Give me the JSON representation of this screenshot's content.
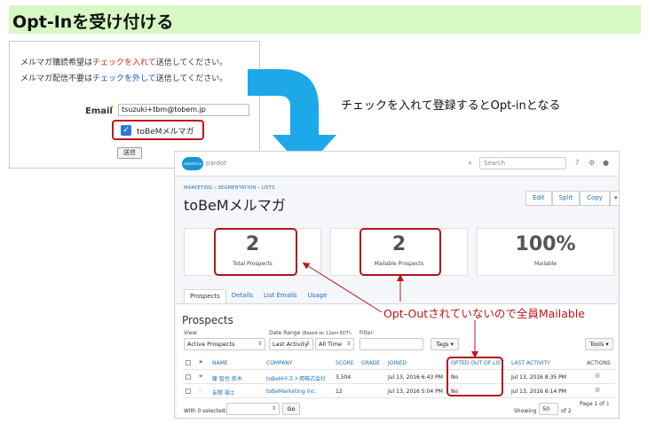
{
  "title": "Opt-Inを受け付ける",
  "form": {
    "line1": {
      "pre": "メルマガ購読希望は",
      "hl": "チェックを入れて",
      "post": "送信してください。"
    },
    "line2": {
      "pre": "メルマガ配信不要は",
      "hl": "チェックを外して",
      "post": "送信してください。"
    },
    "email_label": "Email",
    "required_mark": "*",
    "email_value": "tsuzuki+tbm@tobem.jp",
    "checkbox_label": "toBeMメルマガ",
    "submit_label": "送信"
  },
  "caption": "チェックを入れて登録するとOpt-inとなる",
  "pardot": {
    "logo_text": "salesforce",
    "product": "pardot",
    "search_placeholder": "Search",
    "help_icon": "?",
    "breadcrumb": "MARKETING  ›  SEGMENTATION  ›  LISTS",
    "page_title": "toBeMメルマガ",
    "buttons": [
      "Edit",
      "Split",
      "Copy",
      "▾"
    ],
    "stats": [
      {
        "value": "2",
        "label": "Total Prospects"
      },
      {
        "value": "2",
        "label": "Mailable Prospects"
      },
      {
        "value": "100%",
        "label": "Mailable"
      }
    ],
    "tabs": [
      "Prospects",
      "Details",
      "List Emails",
      "Usage"
    ],
    "section_title": "Prospects",
    "view_label": "View:",
    "view_value": "Active Prospects",
    "date_label": "Date Range",
    "date_note": "(Based on 12am EDT):",
    "date_value1": "Last Activity",
    "date_value2": "All Time",
    "filter_label": "Filter:",
    "tags_label": "Tags ▾",
    "tools_label": "Tools ▾",
    "columns": [
      "NAME",
      "COMPANY",
      "SCORE",
      "GRADE",
      "JOINED",
      "OPTED OUT OF LIST",
      "LAST ACTIVITY",
      "ACTIONS"
    ],
    "rows": [
      {
        "name": "藤 智也 郎木",
        "company": "toBeMテスト用株式会社",
        "score": "3,504",
        "grade": "",
        "joined": "Jul 13, 2016 6:43 PM",
        "opted_out": "No",
        "last_activity": "Jul 13, 2016 8:35 PM"
      },
      {
        "name": "友際 福士",
        "company": "toBeMarketing inc.",
        "score": "12",
        "grade": "",
        "joined": "Jul 13, 2016 5:04 PM",
        "opted_out": "No",
        "last_activity": "Jul 13, 2016 6:14 PM"
      }
    ],
    "selected_label": "With 0 selected:",
    "go_label": "Go",
    "showing_label": "Showing",
    "per_page": "50",
    "of_label": "of 2",
    "page_label": "Page 1 of",
    "page_link": "1"
  },
  "annotation": "Opt-Outされていないので全員Mailable",
  "colors": {
    "title_bg": "#d7f7c4",
    "arrow": "#1da8ea",
    "highlight": "#c0161c",
    "link": "#1b6fb5"
  }
}
